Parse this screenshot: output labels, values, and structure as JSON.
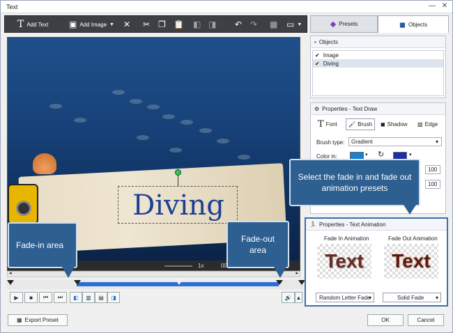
{
  "window": {
    "title": "Text"
  },
  "toolbar": {
    "add_text_label": "Add Text",
    "add_image_label": "Add Image"
  },
  "tabs": [
    {
      "label": "Presets"
    },
    {
      "label": "Objects"
    }
  ],
  "preview": {
    "text": "Diving",
    "speed": "1x",
    "time": "00"
  },
  "objects": {
    "header": "Objects",
    "items": [
      {
        "label": "Image",
        "checked": true
      },
      {
        "label": "Diving",
        "checked": true
      }
    ]
  },
  "properties": {
    "header": "Properties - Text Draw",
    "subtabs": [
      "Font",
      "Brush",
      "Shadow",
      "Edge"
    ],
    "brush_type_label": "Brush type:",
    "brush_type_value": "Gradient",
    "color_in_label": "Color in:",
    "color1": "#1a7fd0",
    "color2": "#1a2fa8",
    "field1": "100",
    "field2": "100"
  },
  "animation": {
    "header": "Properties - Text Animation",
    "fade_in_label": "Fade In Animation",
    "fade_out_label": "Fade Out Animation",
    "preview_text": "Text",
    "fade_in_value": "Random Letter Fade",
    "fade_out_value": "Solid Fade"
  },
  "callouts": {
    "presets": "Select the fade in and fade out animation presets",
    "fade_in": "Fade-in area",
    "fade_out": "Fade-out area"
  },
  "footer": {
    "export_label": "Export Preset",
    "ok_label": "OK",
    "cancel_label": "Cancel"
  }
}
